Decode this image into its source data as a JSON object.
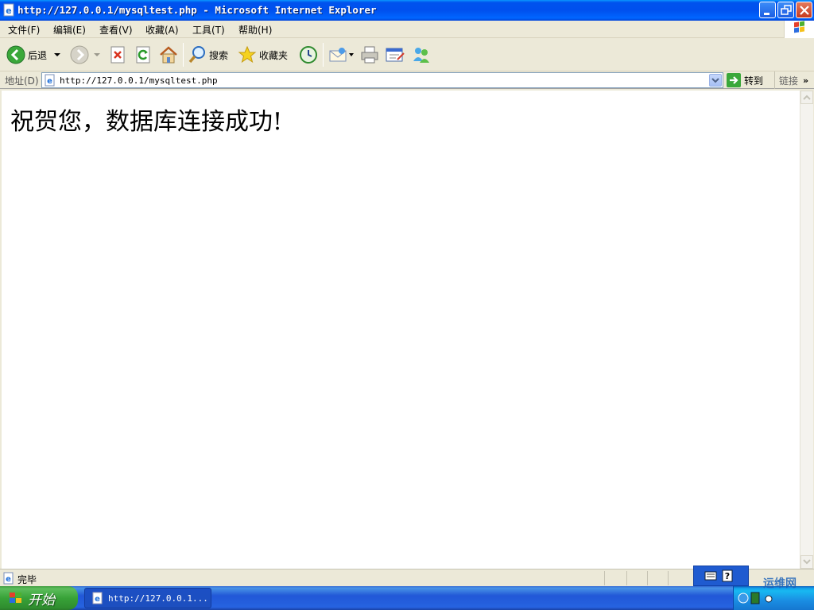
{
  "titlebar": {
    "title": "http://127.0.0.1/mysqltest.php - Microsoft Internet Explorer"
  },
  "menu": [
    "文件(F)",
    "编辑(E)",
    "查看(V)",
    "收藏(A)",
    "工具(T)",
    "帮助(H)"
  ],
  "toolbar": {
    "back_label": "后退",
    "search_label": "搜索",
    "favorites_label": "收藏夹"
  },
  "address": {
    "label": "地址(D)",
    "url": "http://127.0.0.1/mysqltest.php",
    "go_label": "转到",
    "links_label": "链接"
  },
  "content": {
    "message": "祝贺您，数据库连接成功!"
  },
  "status": {
    "text": "完毕"
  },
  "taskbar": {
    "start_label": "开始",
    "task_label": "http://127.0.0.1..."
  },
  "watermark": {
    "text": "运维网"
  },
  "colors": {
    "titlebar": "#0054e3",
    "taskbar": "#245edb",
    "start": "#3c9a3c"
  }
}
